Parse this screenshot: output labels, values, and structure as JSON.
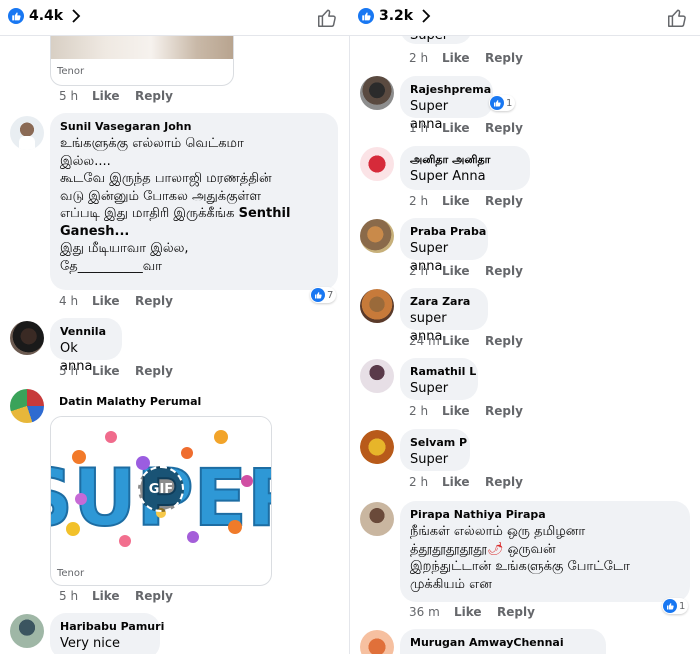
{
  "left": {
    "reactions": {
      "count": "4.4k"
    },
    "tenor_top": {
      "source": "Tenor",
      "time": "5 h",
      "like": "Like",
      "reply": "Reply"
    },
    "comments": [
      {
        "name": "Sunil Vasegaran John",
        "lines": [
          "உங்களுக்கு எல்லாம் வெட்கமா",
          "இல்ல....",
          "கூடவே இருந்த பாலாஜி மரணத்தின்",
          "வடு இன்னும் போகல அதுக்குள்ள"
        ],
        "line5_pre": "எப்படி இது மாதிரி இருக்கீங்க ",
        "mention1": "Senthil",
        "mention2": "Ganesh...",
        "lines_end": [
          "இது மீடியாவா இல்ல,",
          "தே__________வா"
        ],
        "time": "4 h",
        "like": "Like",
        "reply": "Reply",
        "reaction_count": "7"
      },
      {
        "name": "Vennila",
        "text": "Ok anna",
        "time": "5 h",
        "like": "Like",
        "reply": "Reply"
      },
      {
        "name": "Datin Malathy Perumal",
        "gif_label": "GIF",
        "gif_word": "SUPER",
        "source": "Tenor",
        "time": "5 h",
        "like": "Like",
        "reply": "Reply"
      },
      {
        "name": "Haribabu Pamuri",
        "text": "Very nice"
      }
    ]
  },
  "right": {
    "reactions": {
      "count": "3.2k"
    },
    "cut_top": {
      "text": "Super",
      "time": "2 h",
      "like": "Like",
      "reply": "Reply"
    },
    "comments": [
      {
        "name": "Rajeshprema",
        "text": "Super anna",
        "time": "1 h",
        "like": "Like",
        "reply": "Reply",
        "reaction_count": "1"
      },
      {
        "name": "அனிதா அனிதா",
        "text": "Super Anna",
        "time": "2 h",
        "like": "Like",
        "reply": "Reply"
      },
      {
        "name": "Praba Praba",
        "text": "Super anna",
        "time": "2 h",
        "like": "Like",
        "reply": "Reply"
      },
      {
        "name": "Zara Zara",
        "text": "super anna",
        "time": "24 m",
        "like": "Like",
        "reply": "Reply"
      },
      {
        "name": "Ramathil L",
        "text": "Super",
        "time": "2 h",
        "like": "Like",
        "reply": "Reply"
      },
      {
        "name": "Selvam P",
        "text": "Super",
        "time": "2 h",
        "like": "Like",
        "reply": "Reply"
      },
      {
        "name": "Pirapa Nathiya Pirapa",
        "line1": "நீங்கள் எல்லாம் ஒரு தமிழனா",
        "line2": "த்தூதூதூதூதூ",
        "line2_emoji": "🌶",
        "line2_end": " ஒருவன்",
        "line3": "இறந்துட்டான் உங்களுக்கு போட்டோ",
        "line4": "முக்கியம் என",
        "time": "36 m",
        "like": "Like",
        "reply": "Reply",
        "reaction_count": "1"
      },
      {
        "name": "Murugan AmwayChennai"
      }
    ]
  },
  "colors": {
    "facebook_blue": "#1877f2",
    "bubble_bg": "#f0f2f5",
    "meta_gray": "#65676b"
  }
}
